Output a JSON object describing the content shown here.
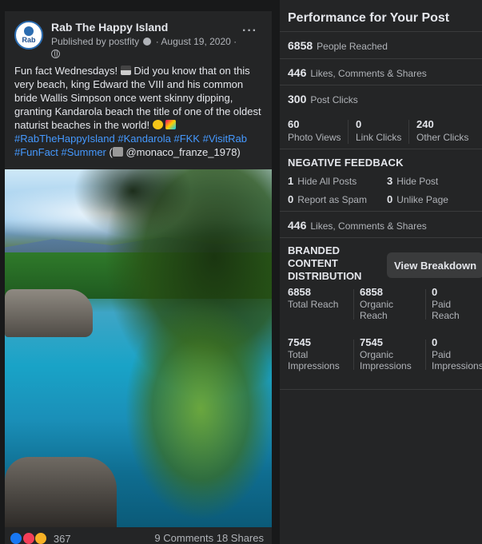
{
  "post": {
    "page_name": "Rab The Happy Island",
    "avatar_text": "Rab",
    "published_by": "Published by postfity",
    "date": "· August 19, 2020 ·",
    "text_main": "Fun fact Wednesdays!",
    "text_body": "Did you know that on this very beach, king Edward the VIII and his common bride Wallis Simpson once went skinny dipping, granting Kandarola beach the title of one of the oldest naturist beaches in the world!",
    "hashtags": "#RabTheHappyIsland #Kandarola #FKK #VisitRab #FunFact #Summer",
    "credit_open": "(",
    "credit": "@monaco_franze_1978)",
    "reaction_count": "367",
    "comments_shares": "9 Comments  18 Shares"
  },
  "panel": {
    "title": "Performance for Your Post",
    "people_reached": {
      "value": "6858",
      "label": "People Reached"
    },
    "engagement": {
      "value": "446",
      "label": "Likes, Comments & Shares"
    },
    "post_clicks": {
      "value": "300",
      "label": "Post Clicks"
    },
    "clicks": [
      {
        "value": "60",
        "label": "Photo Views"
      },
      {
        "value": "0",
        "label": "Link Clicks"
      },
      {
        "value": "240",
        "label": "Other Clicks"
      }
    ],
    "negative_heading": "NEGATIVE FEEDBACK",
    "negative": [
      {
        "value": "1",
        "label": "Hide All Posts"
      },
      {
        "value": "3",
        "label": "Hide Post"
      },
      {
        "value": "0",
        "label": "Report as Spam"
      },
      {
        "value": "0",
        "label": "Unlike Page"
      }
    ],
    "engagement2": {
      "value": "446",
      "label": "Likes, Comments & Shares"
    },
    "branded_heading": "BRANDED CONTENT DISTRIBUTION",
    "view_breakdown": "View Breakdown",
    "reach": [
      {
        "value": "6858",
        "label": "Total Reach"
      },
      {
        "value": "6858",
        "label": "Organic Reach"
      },
      {
        "value": "0",
        "label": "Paid Reach"
      }
    ],
    "impressions": [
      {
        "value": "7545",
        "label": "Total Impressions"
      },
      {
        "value": "7545",
        "label": "Organic Impressions"
      },
      {
        "value": "0",
        "label": "Paid Impressions"
      }
    ]
  }
}
